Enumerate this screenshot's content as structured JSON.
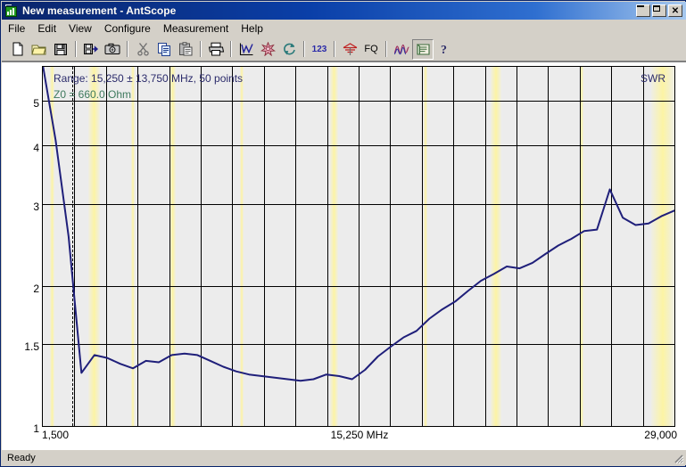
{
  "window": {
    "title": "New measurement - AntScope",
    "icon": "antscope-icon",
    "buttons": {
      "minimize": "minimize-button",
      "maximize": "maximize-button",
      "close": "close-button",
      "close_glyph": "✕"
    }
  },
  "menu": {
    "items": [
      {
        "label": "File"
      },
      {
        "label": "Edit"
      },
      {
        "label": "View"
      },
      {
        "label": "Configure"
      },
      {
        "label": "Measurement"
      },
      {
        "label": "Help"
      }
    ]
  },
  "toolbar": {
    "buttons": [
      {
        "name": "new-icon",
        "label": ""
      },
      {
        "name": "open-icon",
        "label": ""
      },
      {
        "name": "save-icon",
        "label": ""
      },
      {
        "name": "export-icon",
        "label": ""
      },
      {
        "name": "screenshot-icon",
        "label": ""
      },
      {
        "name": "cut-icon",
        "label": ""
      },
      {
        "name": "copy-icon",
        "label": ""
      },
      {
        "name": "paste-icon",
        "label": ""
      },
      {
        "name": "print-icon",
        "label": ""
      },
      {
        "name": "graph-icon",
        "label": ""
      },
      {
        "name": "smith-chart-icon",
        "label": ""
      },
      {
        "name": "refresh-icon",
        "label": ""
      },
      {
        "name": "data-table-icon",
        "label": "123"
      },
      {
        "name": "antenna-icon",
        "label": ""
      },
      {
        "name": "frequency-icon",
        "label": "FQ"
      },
      {
        "name": "multi-swr-icon",
        "label": ""
      },
      {
        "name": "report-icon",
        "label": ""
      },
      {
        "name": "help-icon",
        "label": "?"
      }
    ]
  },
  "chart_data": {
    "type": "line",
    "title": "SWR",
    "range_label": "Range: 15,250 ± 13,750 MHz, 50 points",
    "z0_label": "Z0 = 660.0 Ohm",
    "series_label": "SWR",
    "xlabel": "15,250 MHz",
    "x_min_label": "1,500",
    "x_max_label": "29,000",
    "xlim": [
      1500,
      29000
    ],
    "ylim": [
      1,
      5.9
    ],
    "y_ticks": [
      "5",
      "4",
      "3",
      "2",
      "1.5",
      "1"
    ],
    "y_tick_values": [
      5,
      4,
      3,
      2,
      1.5,
      1
    ],
    "grid": true,
    "legend": "none",
    "line_color": "#1f1f7a",
    "plot_bg": "#ececec",
    "band_color": "#fdf8cf",
    "cursor_freq": 2800,
    "x": [
      1500,
      2061,
      2622,
      3183,
      3744,
      4306,
      4867,
      5428,
      5989,
      6550,
      7111,
      7672,
      8233,
      8794,
      9356,
      9917,
      10478,
      11039,
      11600,
      12161,
      12722,
      13283,
      13844,
      14406,
      14967,
      15528,
      16089,
      16650,
      17211,
      17772,
      18333,
      18894,
      19456,
      20017,
      20578,
      21139,
      21700,
      22261,
      22822,
      23383,
      23944,
      24506,
      25067,
      25628,
      26189,
      26750,
      27311,
      27872,
      28433,
      29000
    ],
    "values": [
      5.95,
      4.1,
      2.55,
      1.3,
      1.42,
      1.4,
      1.36,
      1.33,
      1.38,
      1.37,
      1.42,
      1.43,
      1.42,
      1.38,
      1.34,
      1.31,
      1.29,
      1.28,
      1.27,
      1.26,
      1.25,
      1.26,
      1.29,
      1.28,
      1.26,
      1.32,
      1.41,
      1.48,
      1.55,
      1.6,
      1.7,
      1.78,
      1.85,
      1.95,
      2.05,
      2.12,
      2.2,
      2.18,
      2.24,
      2.34,
      2.44,
      2.52,
      2.62,
      2.64,
      3.22,
      2.8,
      2.7,
      2.72,
      2.82,
      2.9
    ],
    "bands": [
      {
        "from": 1800,
        "to": 2000
      },
      {
        "from": 3500,
        "to": 4000
      },
      {
        "from": 5330,
        "to": 5410
      },
      {
        "from": 7000,
        "to": 7300
      },
      {
        "from": 10100,
        "to": 10150
      },
      {
        "from": 14000,
        "to": 14350
      },
      {
        "from": 18068,
        "to": 18168
      },
      {
        "from": 21000,
        "to": 21450
      },
      {
        "from": 24890,
        "to": 24990
      },
      {
        "from": 28000,
        "to": 29000
      }
    ]
  },
  "statusbar": {
    "text": "Ready"
  }
}
